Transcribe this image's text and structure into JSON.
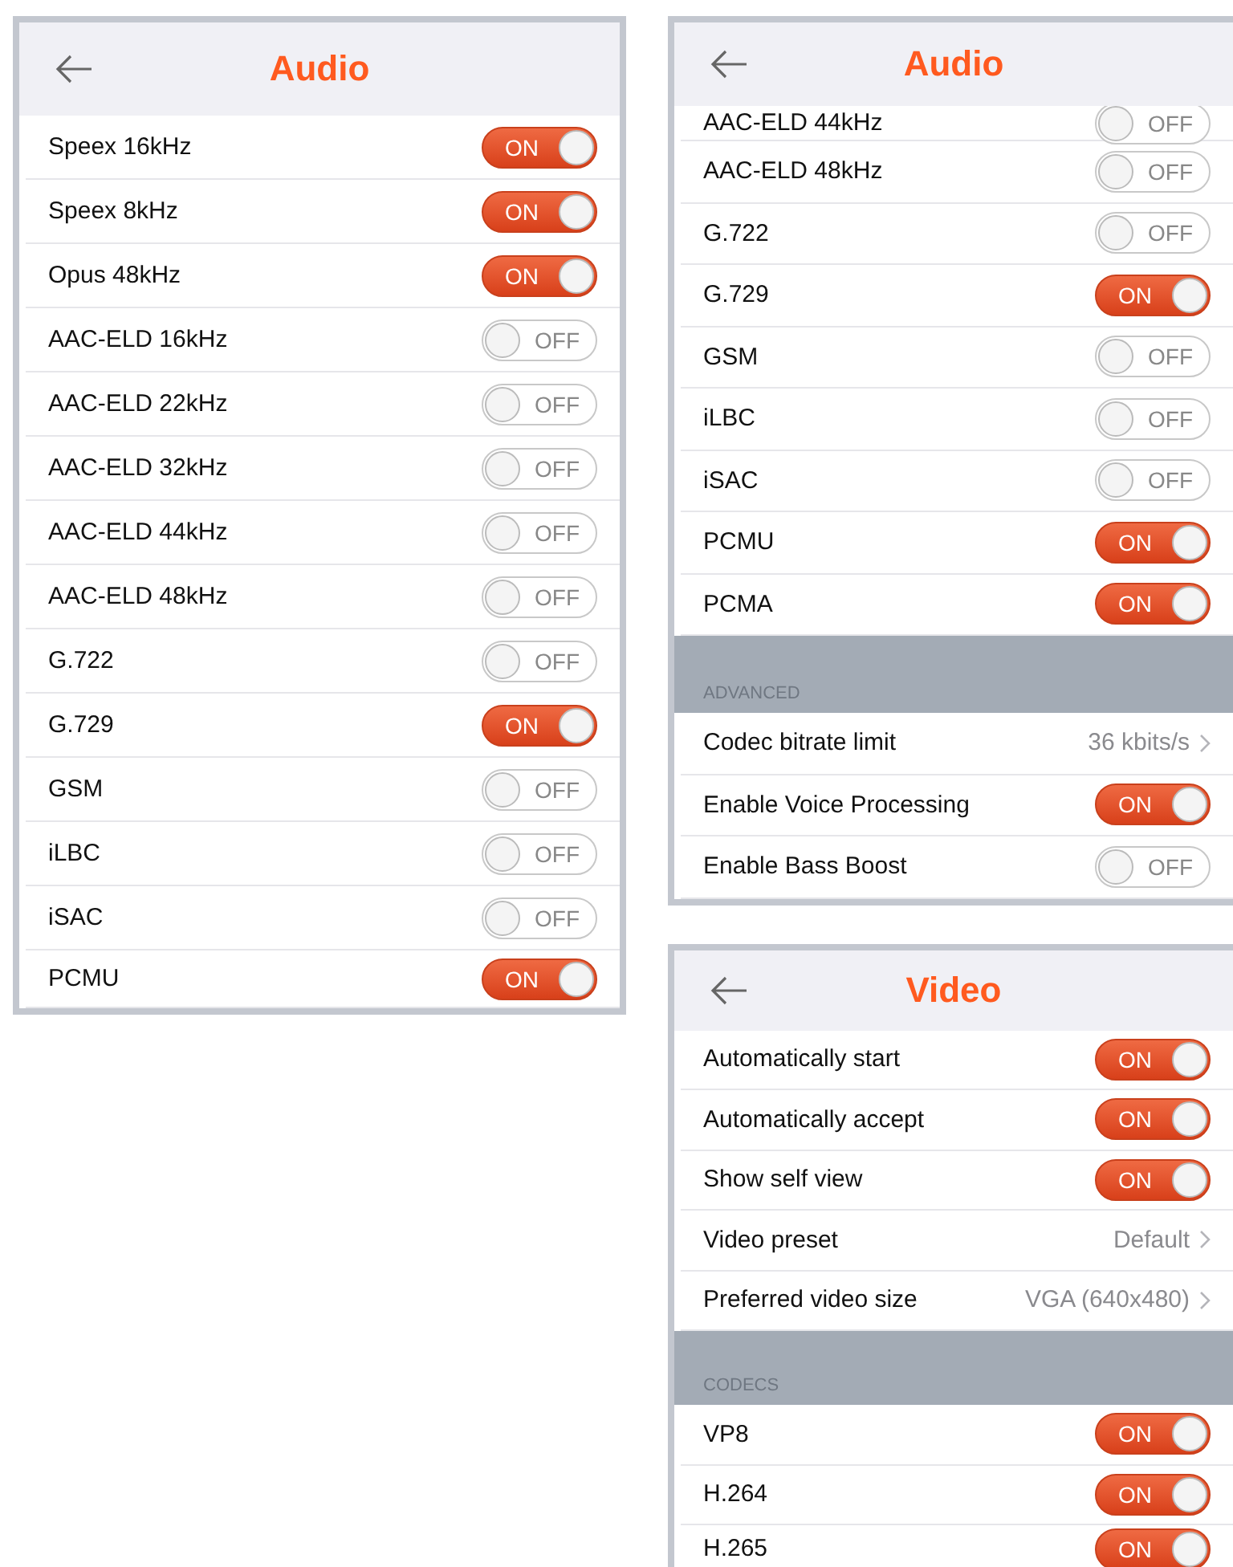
{
  "panels": [
    {
      "title": "Audio",
      "rows": [
        {
          "kind": "toggle",
          "label": "Speex 16kHz",
          "on": true,
          "switch_text": "ON"
        },
        {
          "kind": "toggle",
          "label": "Speex 8kHz",
          "on": true,
          "switch_text": "ON"
        },
        {
          "kind": "toggle",
          "label": "Opus 48kHz",
          "on": true,
          "switch_text": "ON"
        },
        {
          "kind": "toggle",
          "label": "AAC-ELD 16kHz",
          "on": false,
          "switch_text": "OFF"
        },
        {
          "kind": "toggle",
          "label": "AAC-ELD 22kHz",
          "on": false,
          "switch_text": "OFF"
        },
        {
          "kind": "toggle",
          "label": "AAC-ELD 32kHz",
          "on": false,
          "switch_text": "OFF"
        },
        {
          "kind": "toggle",
          "label": "AAC-ELD 44kHz",
          "on": false,
          "switch_text": "OFF"
        },
        {
          "kind": "toggle",
          "label": "AAC-ELD 48kHz",
          "on": false,
          "switch_text": "OFF"
        },
        {
          "kind": "toggle",
          "label": "G.722",
          "on": false,
          "switch_text": "OFF"
        },
        {
          "kind": "toggle",
          "label": "G.729",
          "on": true,
          "switch_text": "ON"
        },
        {
          "kind": "toggle",
          "label": "GSM",
          "on": false,
          "switch_text": "OFF"
        },
        {
          "kind": "toggle",
          "label": "iLBC",
          "on": false,
          "switch_text": "OFF"
        },
        {
          "kind": "toggle",
          "label": "iSAC",
          "on": false,
          "switch_text": "OFF"
        },
        {
          "kind": "toggle",
          "label": "PCMU",
          "on": true,
          "switch_text": "ON"
        }
      ]
    },
    {
      "title": "Audio",
      "rows": [
        {
          "kind": "toggle",
          "label": "AAC-ELD 44kHz",
          "on": false,
          "switch_text": "OFF"
        },
        {
          "kind": "toggle",
          "label": "AAC-ELD 48kHz",
          "on": false,
          "switch_text": "OFF"
        },
        {
          "kind": "toggle",
          "label": "G.722",
          "on": false,
          "switch_text": "OFF"
        },
        {
          "kind": "toggle",
          "label": "G.729",
          "on": true,
          "switch_text": "ON"
        },
        {
          "kind": "toggle",
          "label": "GSM",
          "on": false,
          "switch_text": "OFF"
        },
        {
          "kind": "toggle",
          "label": "iLBC",
          "on": false,
          "switch_text": "OFF"
        },
        {
          "kind": "toggle",
          "label": "iSAC",
          "on": false,
          "switch_text": "OFF"
        },
        {
          "kind": "toggle",
          "label": "PCMU",
          "on": true,
          "switch_text": "ON"
        },
        {
          "kind": "toggle",
          "label": "PCMA",
          "on": true,
          "switch_text": "ON"
        },
        {
          "kind": "section",
          "label": "ADVANCED"
        },
        {
          "kind": "value",
          "label": "Codec bitrate limit",
          "value": "36 kbits/s"
        },
        {
          "kind": "toggle",
          "label": "Enable Voice Processing",
          "on": true,
          "switch_text": "ON"
        },
        {
          "kind": "toggle",
          "label": "Enable Bass Boost",
          "on": false,
          "switch_text": "OFF"
        }
      ]
    },
    {
      "title": "Video",
      "rows": [
        {
          "kind": "toggle",
          "label": "Automatically start",
          "on": true,
          "switch_text": "ON"
        },
        {
          "kind": "toggle",
          "label": "Automatically accept",
          "on": true,
          "switch_text": "ON"
        },
        {
          "kind": "toggle",
          "label": "Show self view",
          "on": true,
          "switch_text": "ON"
        },
        {
          "kind": "value",
          "label": "Video preset",
          "value": "Default"
        },
        {
          "kind": "value",
          "label": "Preferred video size",
          "value": "VGA (640x480)"
        },
        {
          "kind": "section",
          "label": "CODECS"
        },
        {
          "kind": "toggle",
          "label": "VP8",
          "on": true,
          "switch_text": "ON"
        },
        {
          "kind": "toggle",
          "label": "H.264",
          "on": true,
          "switch_text": "ON"
        },
        {
          "kind": "toggle",
          "label": "H.265",
          "on": true,
          "switch_text": "ON"
        }
      ]
    }
  ]
}
